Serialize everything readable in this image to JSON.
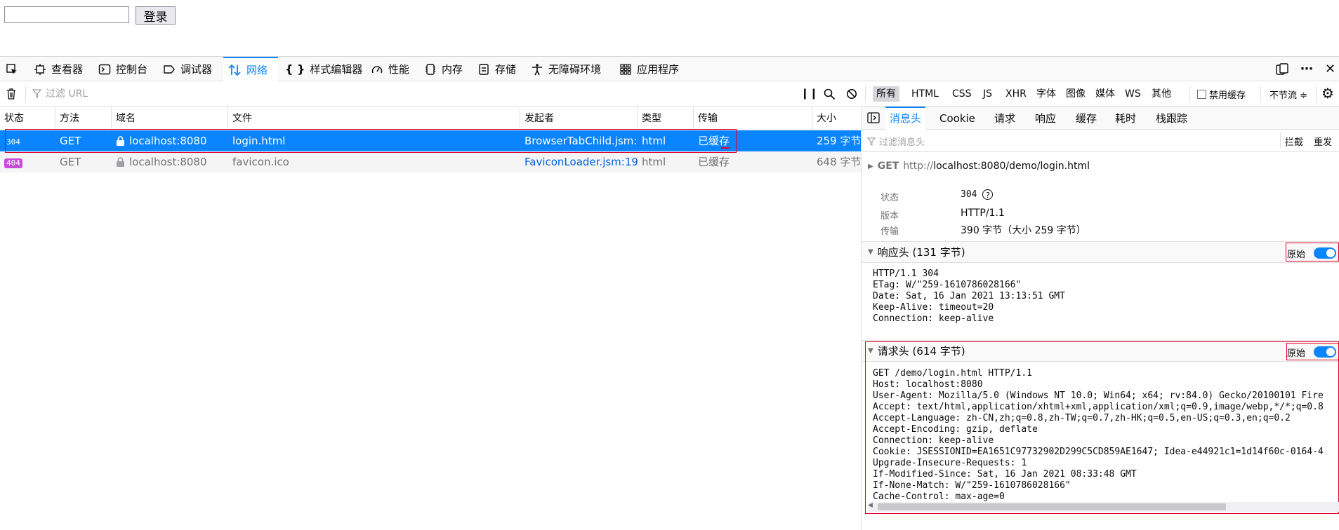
{
  "page": {
    "login_input_value": "",
    "login_button": "登录"
  },
  "toolbar": {
    "tabs": [
      {
        "label": "查看器",
        "icon": "inspector-icon"
      },
      {
        "label": "控制台",
        "icon": "console-icon"
      },
      {
        "label": "调试器",
        "icon": "debugger-icon"
      },
      {
        "label": "网络",
        "icon": "network-icon",
        "active": true
      },
      {
        "label": "样式编辑器",
        "icon": "style-editor-icon"
      },
      {
        "label": "性能",
        "icon": "performance-icon"
      },
      {
        "label": "内存",
        "icon": "memory-icon"
      },
      {
        "label": "存储",
        "icon": "storage-icon"
      },
      {
        "label": "无障碍环境",
        "icon": "accessibility-icon"
      },
      {
        "label": "应用程序",
        "icon": "application-icon"
      }
    ]
  },
  "filterbar": {
    "url_placeholder": "过滤 URL",
    "types": [
      "所有",
      "HTML",
      "CSS",
      "JS",
      "XHR",
      "字体",
      "图像",
      "媒体",
      "WS",
      "其他"
    ],
    "active_type": "所有",
    "disable_cache_label": "禁用缓存",
    "throttle_label": "不节流 ≑"
  },
  "table": {
    "headers": [
      "状态",
      "方法",
      "域名",
      "文件",
      "发起者",
      "类型",
      "传输",
      "大小"
    ],
    "rows": [
      {
        "status": "304",
        "method": "GET",
        "domain": "localhost:8080",
        "file": "login.html",
        "initiator": "BrowserTabChild.jsm:...",
        "type": "html",
        "transfer": "已缓存",
        "size": "259 字节",
        "selected": true
      },
      {
        "status": "404",
        "method": "GET",
        "domain": "localhost:8080",
        "file": "favicon.ico",
        "initiator": "FaviconLoader.jsm:19...",
        "type": "html",
        "transfer": "已缓存",
        "size": "648 字节",
        "selected": false
      }
    ]
  },
  "details": {
    "tabs": [
      "消息头",
      "Cookie",
      "请求",
      "响应",
      "缓存",
      "耗时",
      "栈跟踪"
    ],
    "active_tab": "消息头",
    "filter_placeholder": "过滤消息头",
    "block_label": "拦截",
    "resend_label": "重发",
    "request_line": {
      "method": "GET",
      "url_prefix": "http://",
      "url_rest": "localhost:8080/demo/login.html"
    },
    "summary": [
      {
        "label": "状态",
        "value": "304"
      },
      {
        "label": "版本",
        "value": "HTTP/1.1"
      },
      {
        "label": "传输",
        "value": "390 字节（大小 259 字节）"
      }
    ],
    "response_headers": {
      "title": "响应头 (131 字节)",
      "raw_label": "原始",
      "lines": [
        "HTTP/1.1 304",
        "ETag: W/\"259-1610786028166\"",
        "Date: Sat, 16 Jan 2021 13:13:51 GMT",
        "Keep-Alive: timeout=20",
        "Connection: keep-alive"
      ]
    },
    "request_headers": {
      "title": "请求头 (614 字节)",
      "raw_label": "原始",
      "lines": [
        "GET /demo/login.html HTTP/1.1",
        "Host: localhost:8080",
        "User-Agent: Mozilla/5.0 (Windows NT 10.0; Win64; x64; rv:84.0) Gecko/20100101 Fire",
        "Accept: text/html,application/xhtml+xml,application/xml;q=0.9,image/webp,*/*;q=0.8",
        "Accept-Language: zh-CN,zh;q=0.8,zh-TW;q=0.7,zh-HK;q=0.5,en-US;q=0.3,en;q=0.2",
        "Accept-Encoding: gzip, deflate",
        "Connection: keep-alive",
        "Cookie: JSESSIONID=EA1651C97732902D299C5CD859AE1647; Idea-e44921c1=1d14f60c-0164-4",
        "Upgrade-Insecure-Requests: 1",
        "If-Modified-Since: Sat, 16 Jan 2021 08:33:48 GMT",
        "If-None-Match: W/\"259-1610786028166\"",
        "Cache-Control: max-age=0"
      ]
    }
  },
  "colors": {
    "accent": "#0a84ff",
    "status_404_badge": "#c74cd9",
    "highlight_box": "#e0002a"
  }
}
